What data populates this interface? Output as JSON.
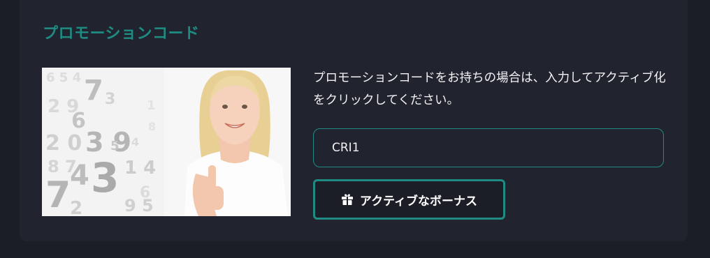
{
  "card": {
    "title": "プロモーションコード"
  },
  "image": {
    "alt": "smiling woman giving a thumbs-up in front of numbers"
  },
  "form": {
    "instructions": "プロモーションコードをお持ちの場合は、入力してアクティブ化をクリックしてください。",
    "code_value": "CRI1",
    "activate_label": "アクティブなボーナス",
    "activate_icon": "gift-icon"
  },
  "colors": {
    "accent": "#1e8c83",
    "card_background": "#21242e",
    "page_background": "#1b1e26",
    "text": "#f1f2f4"
  }
}
